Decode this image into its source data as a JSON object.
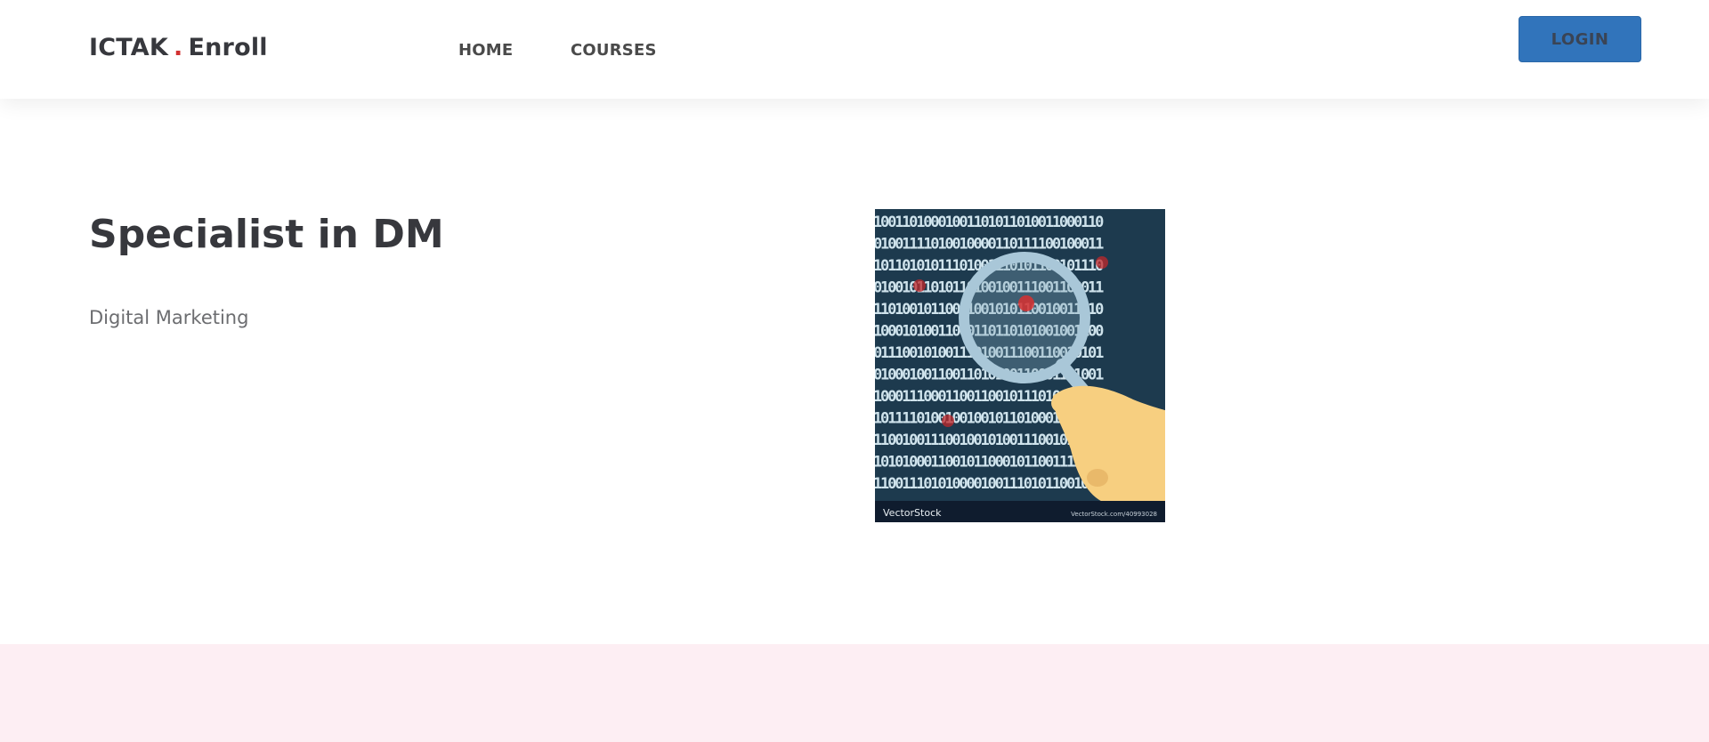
{
  "header": {
    "brand_left": "ICTAK",
    "brand_dot": ".",
    "brand_right": "Enroll",
    "nav": {
      "home": "HOME",
      "courses": "COURSES"
    },
    "login_label": "LOGIN"
  },
  "course": {
    "title": "Specialist in DM",
    "subtitle": "Digital Marketing",
    "image": {
      "icon": "magnifier-binary-icon",
      "watermark_left": "VectorStock",
      "watermark_right": "VectorStock.com/40993028",
      "binary_rows": [
        "10011010001001101011010011000110",
        "01001111010010000110111100100011",
        "10110101011101001110101100101110",
        "01001011010110100100111001100011",
        "11010010110011001010110010011010",
        "10001010011000110110101001001100",
        "01110010100111010011100110010101",
        "01000100110011010100110001101001",
        "10001110001100110010111010010110",
        "10111101001001001011010001111000",
        "11001001110010010100111001010011",
        "10101000110010110001011001111010",
        "11001110101000010011101011001010"
      ]
    }
  },
  "colors": {
    "accent": "#d23131",
    "button": "#3174bb",
    "band": "#fdeef3",
    "image_bg": "#1d3a4e",
    "binary": "#cfe3ec",
    "hand": "#f7cf80"
  }
}
